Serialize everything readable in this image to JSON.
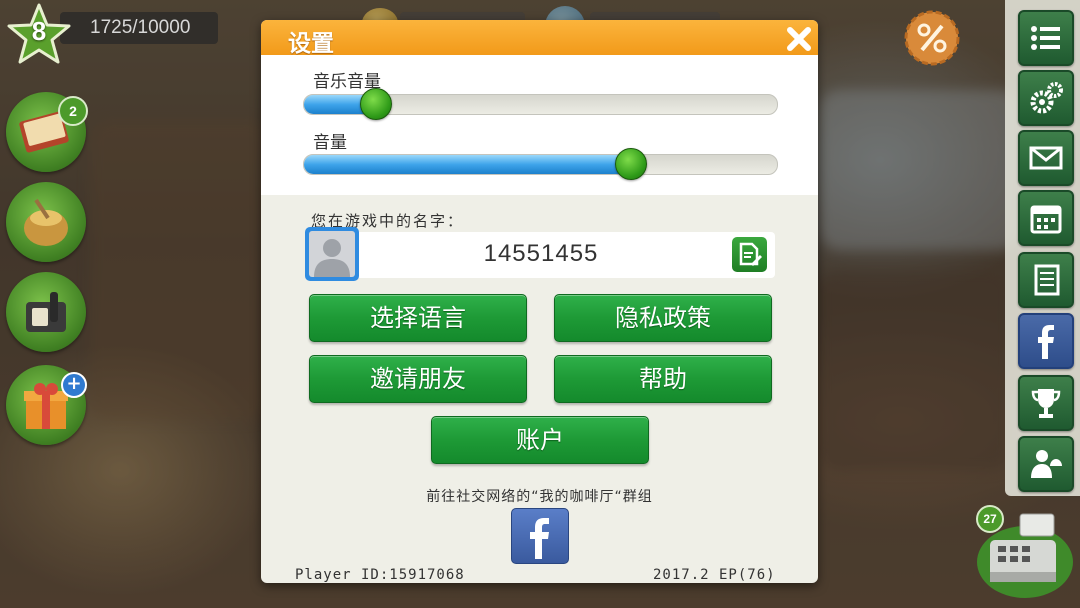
{
  "hud": {
    "level": "8",
    "xp": "1725/10000",
    "sidebar_badges": {
      "recipes_count": "2",
      "gift_plus": "+"
    },
    "register_count": "27"
  },
  "icons": {
    "level": "star-icon",
    "discount": "percent-icon",
    "recipes": "recipe-book-icon",
    "ingredients": "ingredients-bag-icon",
    "phone": "phone-icon",
    "gift": "gift-icon",
    "menu": [
      "list-icon",
      "gears-icon",
      "mail-icon",
      "calendar-icon",
      "notes-icon",
      "facebook-icon",
      "trophy-icon",
      "waiter-icon"
    ],
    "register": "cash-register-icon"
  },
  "dialog": {
    "title": "设置",
    "music_volume_label": "音乐音量",
    "music_volume": 0.15,
    "sound_volume_label": "音量",
    "sound_volume": 0.69,
    "name_label": "您在游戏中的名字：",
    "player_name": "14551455",
    "buttons": {
      "language": "选择语言",
      "privacy": "隐私政策",
      "invite": "邀请朋友",
      "help": "帮助",
      "account": "账户"
    },
    "social_text": "前往社交网络的“我的咖啡厅“群组",
    "player_id": "Player ID:15917068",
    "version": "2017.2 EP(76)"
  },
  "colors": {
    "header_orange": "#f29a1a",
    "button_green": "#1e9a36",
    "slider_blue": "#3ea4ea",
    "facebook_blue": "#3a5a9e"
  }
}
